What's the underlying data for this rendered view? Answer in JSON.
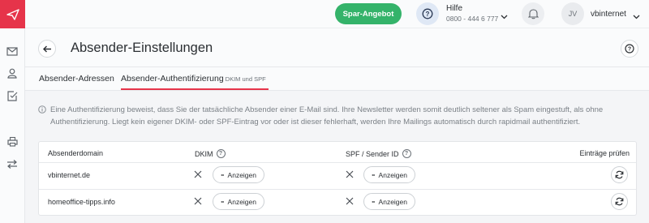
{
  "topbar": {
    "promo_label": "Spar-Angebot",
    "help_label": "Hilfe",
    "help_phone": "0800 - 444 6 777",
    "avatar_initials": "JV",
    "user_name": "vbinternet"
  },
  "header": {
    "title": "Absender-Einstellungen"
  },
  "tabs": [
    {
      "label": "Absender-Adressen",
      "sub": ""
    },
    {
      "label": "Absender-Authentifizierung",
      "sub": "DKIM und SPF"
    }
  ],
  "info_text": "Eine Authentifizierung beweist, dass Sie der tatsächliche Absender einer E-Mail sind. Ihre Newsletter werden somit deutlich seltener als Spam eingestuft, als ohne Authentifizierung. Liegt kein eigener DKIM- oder SPF-Eintrag vor oder ist dieser fehlerhaft, werden Ihre Mailings automatisch durch rapidmail authentifiziert.",
  "table": {
    "headers": {
      "domain": "Absenderdomain",
      "dkim": "DKIM",
      "spf": "SPF / Sender ID",
      "check": "Einträge prüfen"
    },
    "show_label": "Anzeigen",
    "rows": [
      {
        "domain": "vbinternet.de"
      },
      {
        "domain": "homeoffice-tipps.info"
      }
    ]
  },
  "colors": {
    "brand": "#e6344a",
    "promo": "#34b36a"
  }
}
